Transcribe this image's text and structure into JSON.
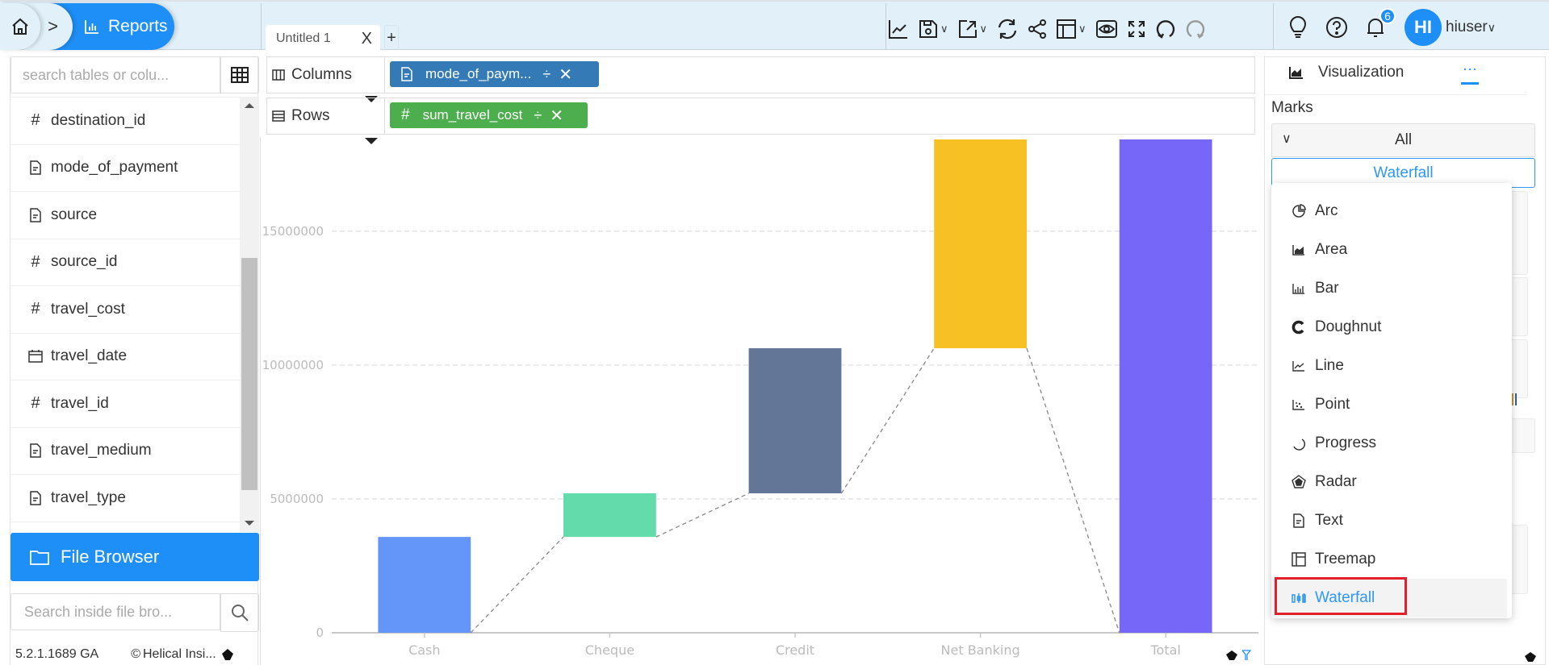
{
  "breadcrumb": {
    "home_icon": "home-icon",
    "separator": ">",
    "current": "Reports",
    "current_icon": "bar-chart-icon"
  },
  "tabs": [
    {
      "label": "Untitled 1",
      "close": "X"
    }
  ],
  "tab_add": "+",
  "toolbar": {
    "icons": [
      "line-chart-icon",
      "save-icon",
      "export-icon",
      "refresh-icon",
      "share-icon",
      "layout-icon",
      "preview-icon",
      "fullscreen-icon",
      "undo-icon",
      "redo-icon"
    ]
  },
  "header_right": {
    "notification_count": "6",
    "avatar_initials": "HI",
    "username": "hiuser",
    "username_chevron": "∨"
  },
  "left_panel": {
    "search_placeholder": "search tables or colu...",
    "fields": [
      {
        "name": "destination_id",
        "type": "number"
      },
      {
        "name": "mode_of_payment",
        "type": "text"
      },
      {
        "name": "source",
        "type": "text"
      },
      {
        "name": "source_id",
        "type": "number"
      },
      {
        "name": "travel_cost",
        "type": "number"
      },
      {
        "name": "travel_date",
        "type": "date"
      },
      {
        "name": "travel_id",
        "type": "number"
      },
      {
        "name": "travel_medium",
        "type": "text"
      },
      {
        "name": "travel_type",
        "type": "text"
      }
    ],
    "file_browser_label": "File Browser",
    "file_search_placeholder": "Search inside file bro...",
    "version": "5.2.1.1689 GA",
    "copyright": "Helical Insi..."
  },
  "shelves": {
    "columns_label": "Columns",
    "rows_label": "Rows",
    "columns_pill": {
      "label": "mode_of_paym...",
      "type": "text",
      "color": "#337ab7"
    },
    "rows_pill": {
      "label": "sum_travel_cost",
      "type": "number",
      "color": "#4cae4c"
    }
  },
  "right_panel": {
    "visualization_tab": "Visualization",
    "more_tab": "···",
    "marks_label": "Marks",
    "marks_selector": "All",
    "current_type": "Waterfall",
    "chart_types": [
      {
        "label": "Arc",
        "icon": "arc-icon"
      },
      {
        "label": "Area",
        "icon": "area-chart-icon"
      },
      {
        "label": "Bar",
        "icon": "bar-chart-icon"
      },
      {
        "label": "Doughnut",
        "icon": "doughnut-icon"
      },
      {
        "label": "Line",
        "icon": "line-chart-icon"
      },
      {
        "label": "Point",
        "icon": "scatter-icon"
      },
      {
        "label": "Progress",
        "icon": "progress-icon"
      },
      {
        "label": "Radar",
        "icon": "radar-icon"
      },
      {
        "label": "Text",
        "icon": "text-icon"
      },
      {
        "label": "Treemap",
        "icon": "treemap-icon"
      },
      {
        "label": "Waterfall",
        "icon": "waterfall-icon",
        "selected": true
      }
    ],
    "highlight_color": "#e3202a",
    "accent_color": "#2f97f5"
  },
  "chart_data": {
    "type": "waterfall",
    "title": "",
    "xlabel": "",
    "ylabel": "",
    "categories": [
      "Cash",
      "Cheque",
      "Credit",
      "Net Banking",
      "Total"
    ],
    "values": [
      3580000,
      1630000,
      5420000,
      7800000,
      18430000
    ],
    "ranges": [
      [
        0,
        3580000
      ],
      [
        3580000,
        5210000
      ],
      [
        5210000,
        10630000
      ],
      [
        10630000,
        18430000
      ],
      [
        0,
        18430000
      ]
    ],
    "colors": [
      "#6495f9",
      "#64dbab",
      "#647697",
      "#f7c123",
      "#7767f8"
    ],
    "ylim": [
      0,
      18430000
    ],
    "yticks": [
      0,
      5000000,
      10000000,
      15000000
    ],
    "ytick_labels": [
      "0",
      "5000000",
      "10000000",
      "15000000"
    ],
    "grid": true,
    "connector_lines": "dashed"
  }
}
